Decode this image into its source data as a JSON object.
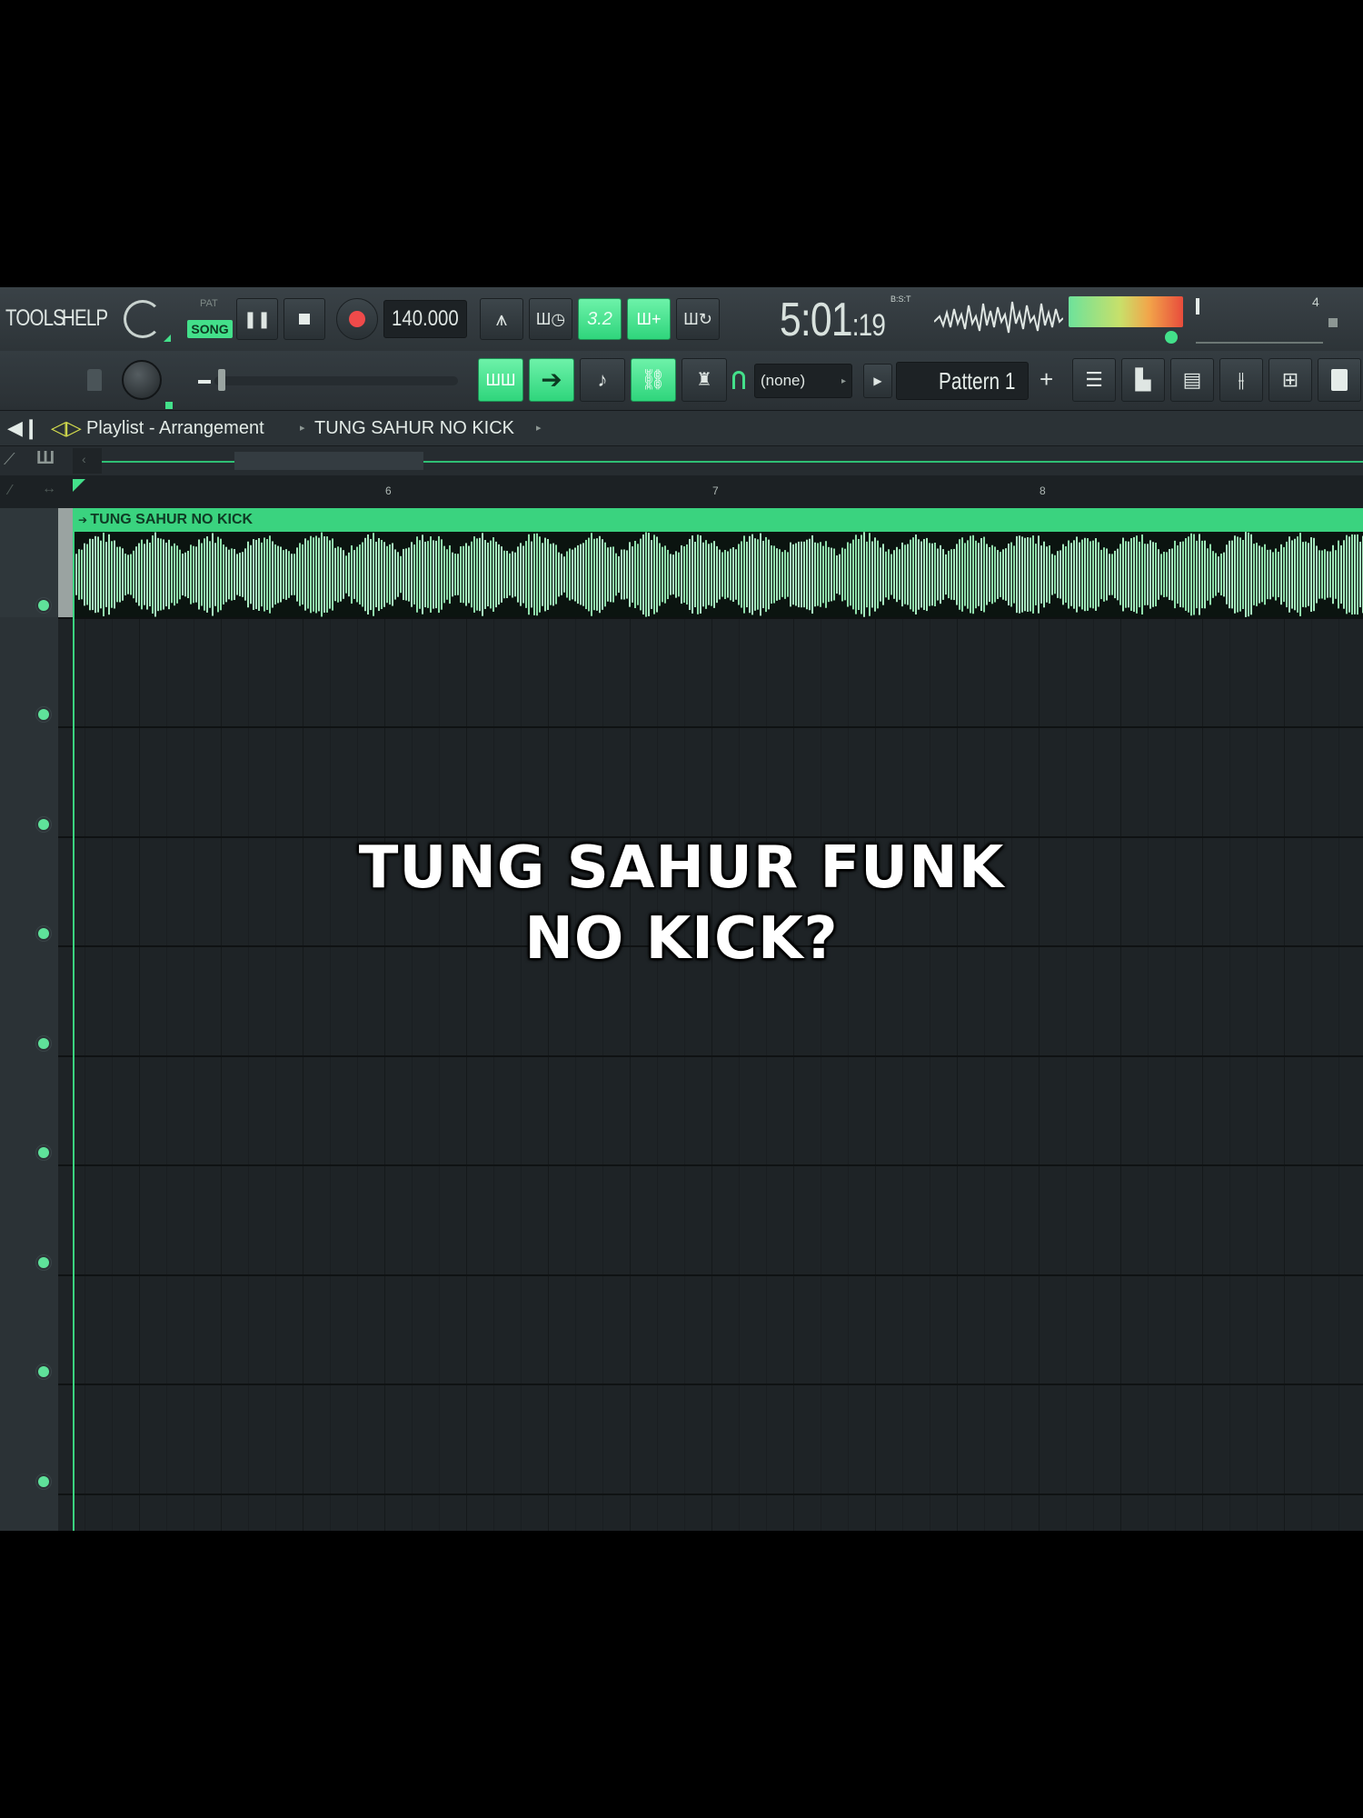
{
  "menu": {
    "tools": "TOOLS",
    "help": "HELP"
  },
  "transport": {
    "pat_label": "PAT",
    "song_label": "SONG",
    "tempo": "140.000",
    "step_label": "3.2",
    "time_main": "5:01",
    "time_sub": ":19",
    "time_format": "B:S:T",
    "cpu_count": "4"
  },
  "toolbar2": {
    "snap_value": "(none)",
    "pattern": "Pattern 1",
    "add": "+"
  },
  "breadcrumb": {
    "window": "Playlist - Arrangement",
    "item": "TUNG SAHUR NO KICK"
  },
  "ruler": {
    "marks": [
      "6",
      "7",
      "8"
    ]
  },
  "clip": {
    "name": "TUNG SAHUR NO KICK",
    "color": "#3ad37f"
  },
  "overlay": {
    "line1": "TUNG SAHUR FUNK",
    "line2": "NO KICK?"
  },
  "colors": {
    "accent": "#43e08a",
    "background": "#22282c"
  }
}
